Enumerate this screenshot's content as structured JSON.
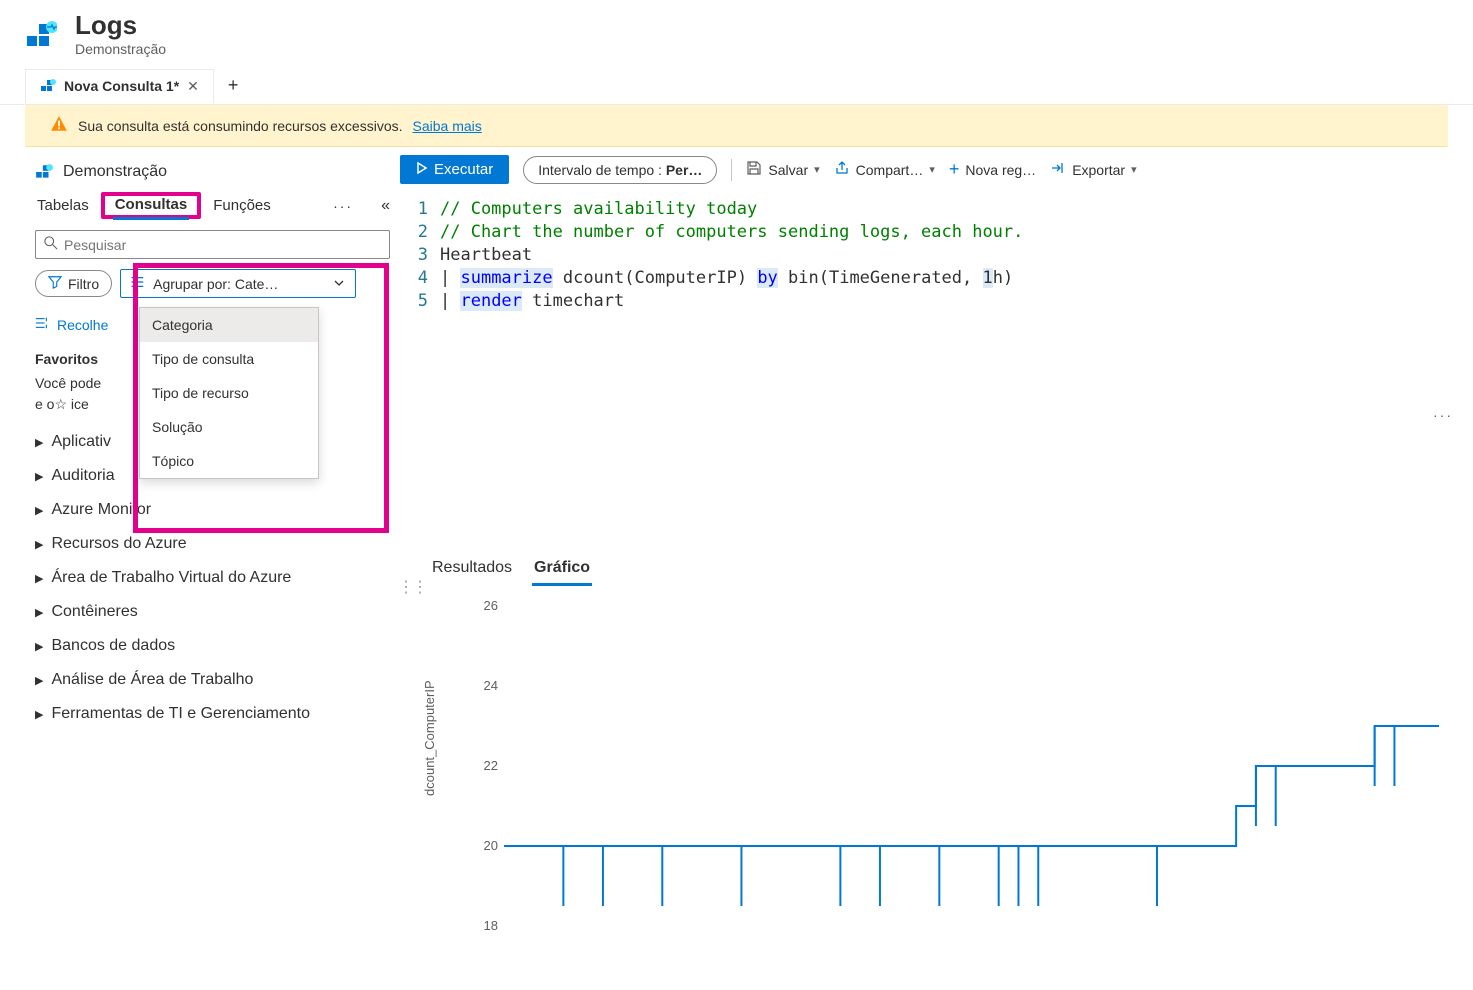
{
  "header": {
    "title": "Logs",
    "subtitle": "Demonstração"
  },
  "tab": {
    "label": "Nova Consulta 1*",
    "close": "✕",
    "add": "+"
  },
  "warning": {
    "text": "Sua consulta está consumindo recursos excessivos.",
    "link": "Saiba mais"
  },
  "toolbar": {
    "run": "Executar",
    "time_prefix": "Intervalo de tempo : ",
    "time_value": "Per…",
    "save": "Salvar",
    "share": "Compart…",
    "new": "Nova reg…",
    "export": "Exportar"
  },
  "scope": "Demonstração",
  "side_tabs": {
    "tables": "Tabelas",
    "queries": "Consultas",
    "functions": "Funções",
    "more": "···",
    "collapse": "«"
  },
  "search": {
    "placeholder": "Pesquisar"
  },
  "filter": {
    "label": "Filtro"
  },
  "group": {
    "label": "Agrupar por: Cate…"
  },
  "dropdown": {
    "items": [
      "Categoria",
      "Tipo de consulta",
      "Tipo de recurso",
      "Solução",
      "Tópico"
    ]
  },
  "collapse_all": "Recolhe",
  "favorites": {
    "title": "Favoritos",
    "body1": "Você pode",
    "body2": "e o☆ ice"
  },
  "categories": [
    "Aplicativ",
    "Auditoria",
    "Azure Monitor",
    "Recursos do Azure",
    "Área de Trabalho Virtual do Azure",
    "Contêineres",
    "Bancos de dados",
    "Análise de Área de Trabalho",
    "Ferramentas de TI e Gerenciamento"
  ],
  "editor": {
    "lines": [
      {
        "n": "1",
        "segs": [
          {
            "t": "// Computers availability today",
            "c": "c-comment"
          }
        ]
      },
      {
        "n": "2",
        "segs": [
          {
            "t": "// Chart the number of computers sending logs, each hour.",
            "c": "c-comment"
          }
        ]
      },
      {
        "n": "3",
        "segs": [
          {
            "t": "Heartbeat",
            "c": ""
          }
        ]
      },
      {
        "n": "4",
        "segs": [
          {
            "t": "| ",
            "c": ""
          },
          {
            "t": "summarize",
            "c": "c-kw c-hl"
          },
          {
            "t": " dcount(ComputerIP) ",
            "c": ""
          },
          {
            "t": "by",
            "c": "c-kw c-hl"
          },
          {
            "t": " bin(TimeGenerated, ",
            "c": ""
          },
          {
            "t": "1",
            "c": "c-hl"
          },
          {
            "t": "h)",
            "c": ""
          }
        ]
      },
      {
        "n": "5",
        "segs": [
          {
            "t": "| ",
            "c": ""
          },
          {
            "t": "render",
            "c": "c-kw c-hl"
          },
          {
            "t": " timechart",
            "c": ""
          }
        ]
      }
    ]
  },
  "result_tabs": {
    "results": "Resultados",
    "chart": "Gráfico"
  },
  "chart_data": {
    "type": "line",
    "ylabel": "dcount_ComputerIP",
    "ylim": [
      18,
      26
    ],
    "yticks": [
      18,
      20,
      22,
      24,
      26
    ],
    "x": [
      0,
      1,
      2,
      3,
      4,
      5,
      6,
      7,
      8,
      9,
      10,
      11,
      12,
      13,
      14,
      15,
      16,
      17,
      18,
      19,
      20,
      21,
      22,
      23,
      24,
      25,
      26,
      27,
      28,
      29,
      30,
      31,
      32,
      33,
      34,
      35,
      36,
      37,
      38,
      39,
      40,
      41,
      42,
      43,
      44,
      45,
      46,
      47
    ],
    "values": [
      20,
      20,
      20,
      20,
      20,
      20,
      20,
      20,
      20,
      20,
      20,
      20,
      20,
      20,
      20,
      20,
      20,
      20,
      20,
      20,
      20,
      20,
      20,
      20,
      20,
      20,
      20,
      20,
      20,
      20,
      20,
      20,
      20,
      20,
      20,
      20,
      20,
      21,
      22,
      22,
      22,
      22,
      22,
      22,
      23,
      23,
      23,
      23
    ],
    "dips": [
      3,
      5,
      8,
      12,
      17,
      19,
      22,
      25,
      26,
      27,
      33,
      38,
      39,
      44,
      45
    ]
  }
}
